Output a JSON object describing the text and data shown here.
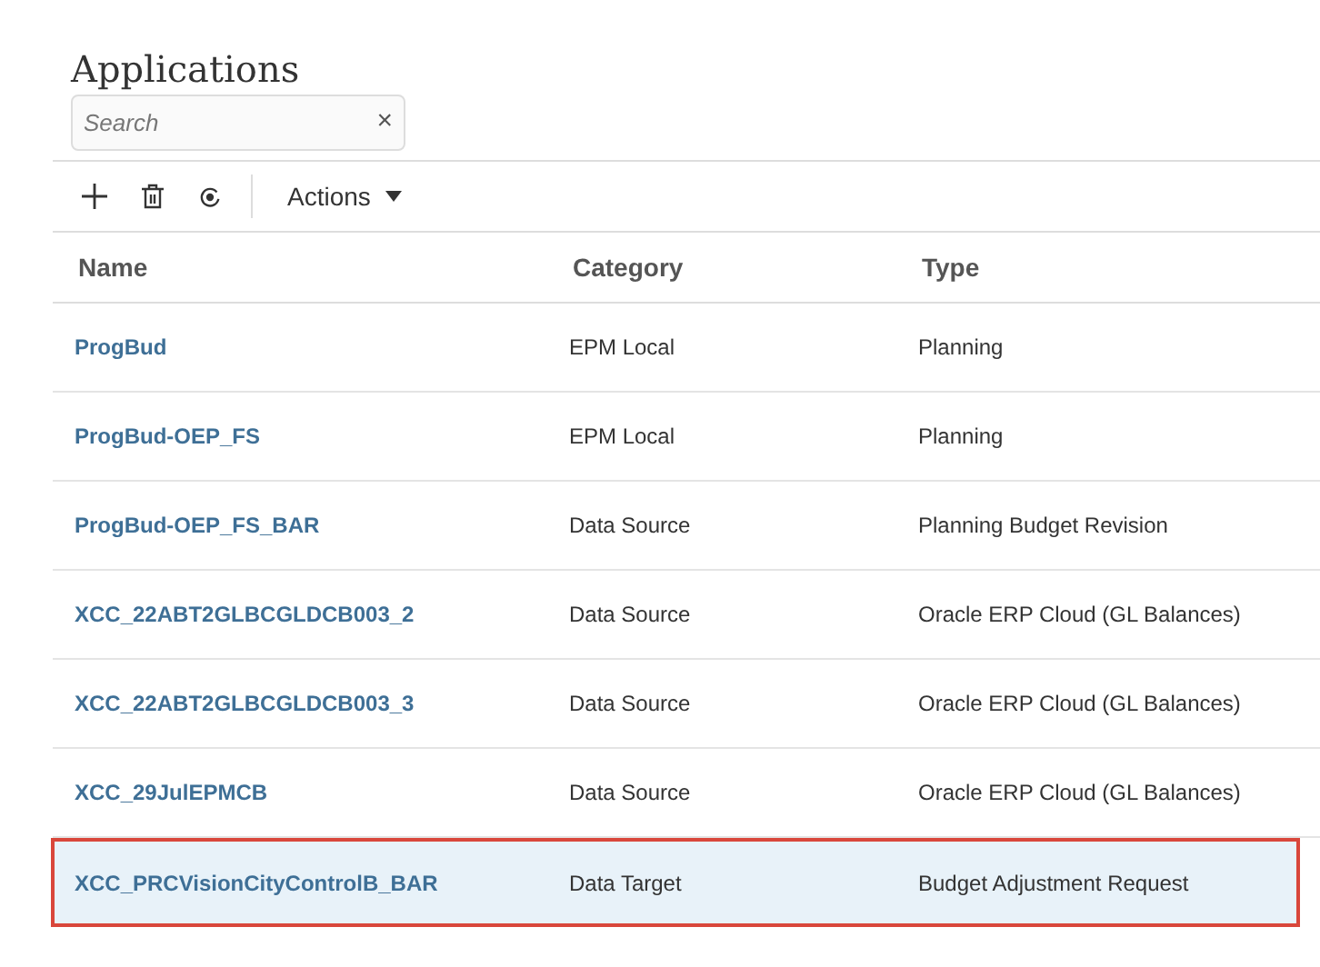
{
  "title": "Applications",
  "search": {
    "placeholder": "Search",
    "clear": "×"
  },
  "toolbar": {
    "actions_label": "Actions"
  },
  "table": {
    "columns": [
      "Name",
      "Category",
      "Type"
    ],
    "rows": [
      {
        "name": "ProgBud",
        "category": "EPM Local",
        "type": "Planning",
        "selected": false
      },
      {
        "name": "ProgBud-OEP_FS",
        "category": "EPM Local",
        "type": "Planning",
        "selected": false
      },
      {
        "name": "ProgBud-OEP_FS_BAR",
        "category": "Data Source",
        "type": "Planning Budget Revision",
        "selected": false
      },
      {
        "name": "XCC_22ABT2GLBCGLDCB003_2",
        "category": "Data Source",
        "type": "Oracle ERP Cloud (GL Balances)",
        "selected": false
      },
      {
        "name": "XCC_22ABT2GLBCGLDCB003_3",
        "category": "Data Source",
        "type": "Oracle ERP Cloud (GL Balances)",
        "selected": false
      },
      {
        "name": "XCC_29JulEPMCB",
        "category": "Data Source",
        "type": "Oracle ERP Cloud (GL Balances)",
        "selected": false
      },
      {
        "name": "XCC_PRCVisionCityControlB_BAR",
        "category": "Data Target",
        "type": "Budget Adjustment Request",
        "selected": true
      }
    ]
  }
}
